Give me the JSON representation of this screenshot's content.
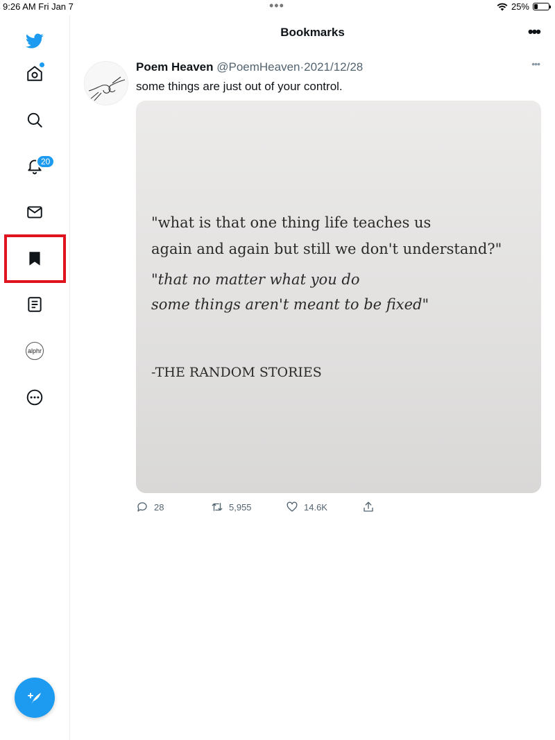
{
  "status_bar": {
    "time": "9:26 AM  Fri Jan 7",
    "battery": "25%",
    "battery_level": 0.25,
    "multitask_dots": "•••"
  },
  "sidebar": {
    "items": [
      {
        "name": "home",
        "icon": "home-icon",
        "has_dot": true
      },
      {
        "name": "explore",
        "icon": "search-icon"
      },
      {
        "name": "notifications",
        "icon": "bell-icon",
        "badge": "20"
      },
      {
        "name": "messages",
        "icon": "mail-icon"
      },
      {
        "name": "bookmarks",
        "icon": "bookmark-icon",
        "active": true,
        "highlighted": true
      },
      {
        "name": "lists",
        "icon": "list-icon"
      },
      {
        "name": "profile",
        "icon": "profile-avatar",
        "label": "alphr"
      },
      {
        "name": "more",
        "icon": "more-circle-icon"
      }
    ],
    "compose_icon": "compose-tweet-icon"
  },
  "header": {
    "title": "Bookmarks",
    "more": "•••"
  },
  "tweet": {
    "name": "Poem Heaven",
    "handle": "@PoemHeaven",
    "separator": "·",
    "date": "2021/12/28",
    "text": "some things are just out of your control.",
    "more": "•••",
    "image_text": {
      "line1": "\"what is that one thing life teaches us",
      "line2": "again and again but still we don't understand?\"",
      "line3": "\"that no matter what you do",
      "line4": "some things aren't meant to be fixed\"",
      "attribution": "-THE RANDOM STORIES"
    },
    "actions": {
      "replies": "28",
      "retweets": "5,955",
      "likes": "14.6K"
    }
  },
  "colors": {
    "accent": "#1d9bf0",
    "highlight": "#e0141f",
    "text": "#0f1419",
    "muted": "#536471"
  }
}
